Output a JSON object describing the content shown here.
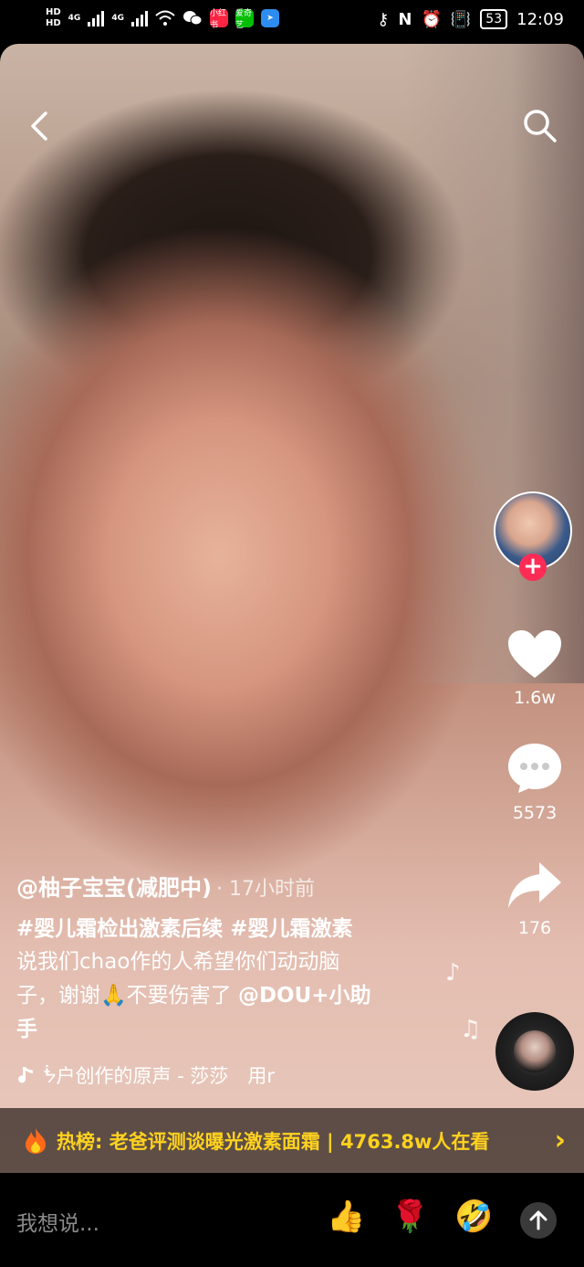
{
  "status_bar": {
    "hd1": "HD",
    "hd2": "HD",
    "network1": "4G",
    "network2": "4G",
    "app_badge1": "小红书",
    "app_badge2": "爱奇艺",
    "battery": "53",
    "time": "12:09"
  },
  "video": {
    "like_count": "1.6w",
    "comment_count": "5573",
    "share_count": "176",
    "follow_symbol": "+"
  },
  "post": {
    "author": "@柚子宝宝(减肥中)",
    "time_ago": "· 17小时前",
    "hashtags": "#婴儿霜检出激素后续 #婴儿霜激素",
    "description_line1": "说我们chao作的人希望你们动动脑",
    "description_line2a": "子，谢谢🙏不要伤害了 ",
    "mention": "@DOU+小助",
    "mention_cont": "手",
    "music": "ᖭ户创作的原声 - 莎莎　用𝗋"
  },
  "hot": {
    "icon": "flame-icon",
    "text": "热榜: 老爸评测谈曝光激素面霜 | 4763.8w人在看",
    "arrow": "›"
  },
  "composer": {
    "placeholder": "我想说...",
    "emojis": [
      "👍",
      "🌹",
      "🤣"
    ]
  },
  "colors": {
    "follow_red": "#fe2c55",
    "hot_yellow": "#ffd21e"
  }
}
